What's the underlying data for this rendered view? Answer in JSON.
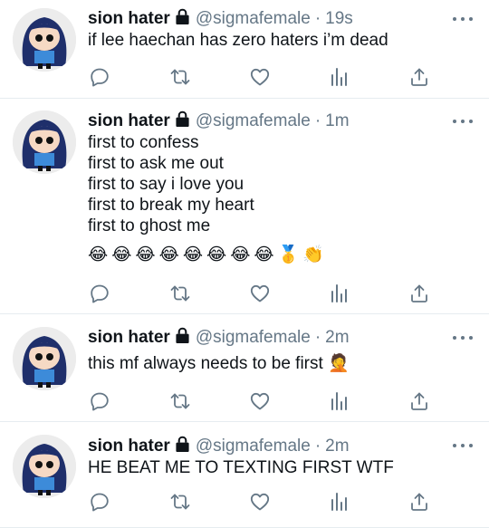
{
  "tweets": [
    {
      "author": "sion hater",
      "handle": "@sigmafemale",
      "separator": "·",
      "time": "19s",
      "text": "if lee haechan has zero haters i’m dead"
    },
    {
      "author": "sion hater",
      "handle": "@sigmafemale",
      "separator": "·",
      "time": "1m",
      "text": "first to confess\nfirst to ask me out\nfirst to say i love you\nfirst to break my heart\nfirst to ghost me",
      "emojis": [
        "😂",
        "😂",
        "😂",
        "😂",
        "😂",
        "😂",
        "😂",
        "😂",
        "🥇",
        "👏"
      ]
    },
    {
      "author": "sion hater",
      "handle": "@sigmafemale",
      "separator": "·",
      "time": "2m",
      "text": "this mf always needs to be first 🤦"
    },
    {
      "author": "sion hater",
      "handle": "@sigmafemale",
      "separator": "·",
      "time": "2m",
      "text": "HE BEAT ME TO TEXTING FIRST WTF"
    }
  ],
  "icons": {
    "reply": "reply-icon",
    "retweet": "retweet-icon",
    "like": "heart-icon",
    "analytics": "analytics-icon",
    "share": "share-icon",
    "lock": "lock-icon",
    "more": "more-icon"
  },
  "colors": {
    "icon": "#657786",
    "text": "#0f1419",
    "divider": "#e6ecf0",
    "hair": "#1f2f6b",
    "shirt": "#3d8bd9"
  }
}
